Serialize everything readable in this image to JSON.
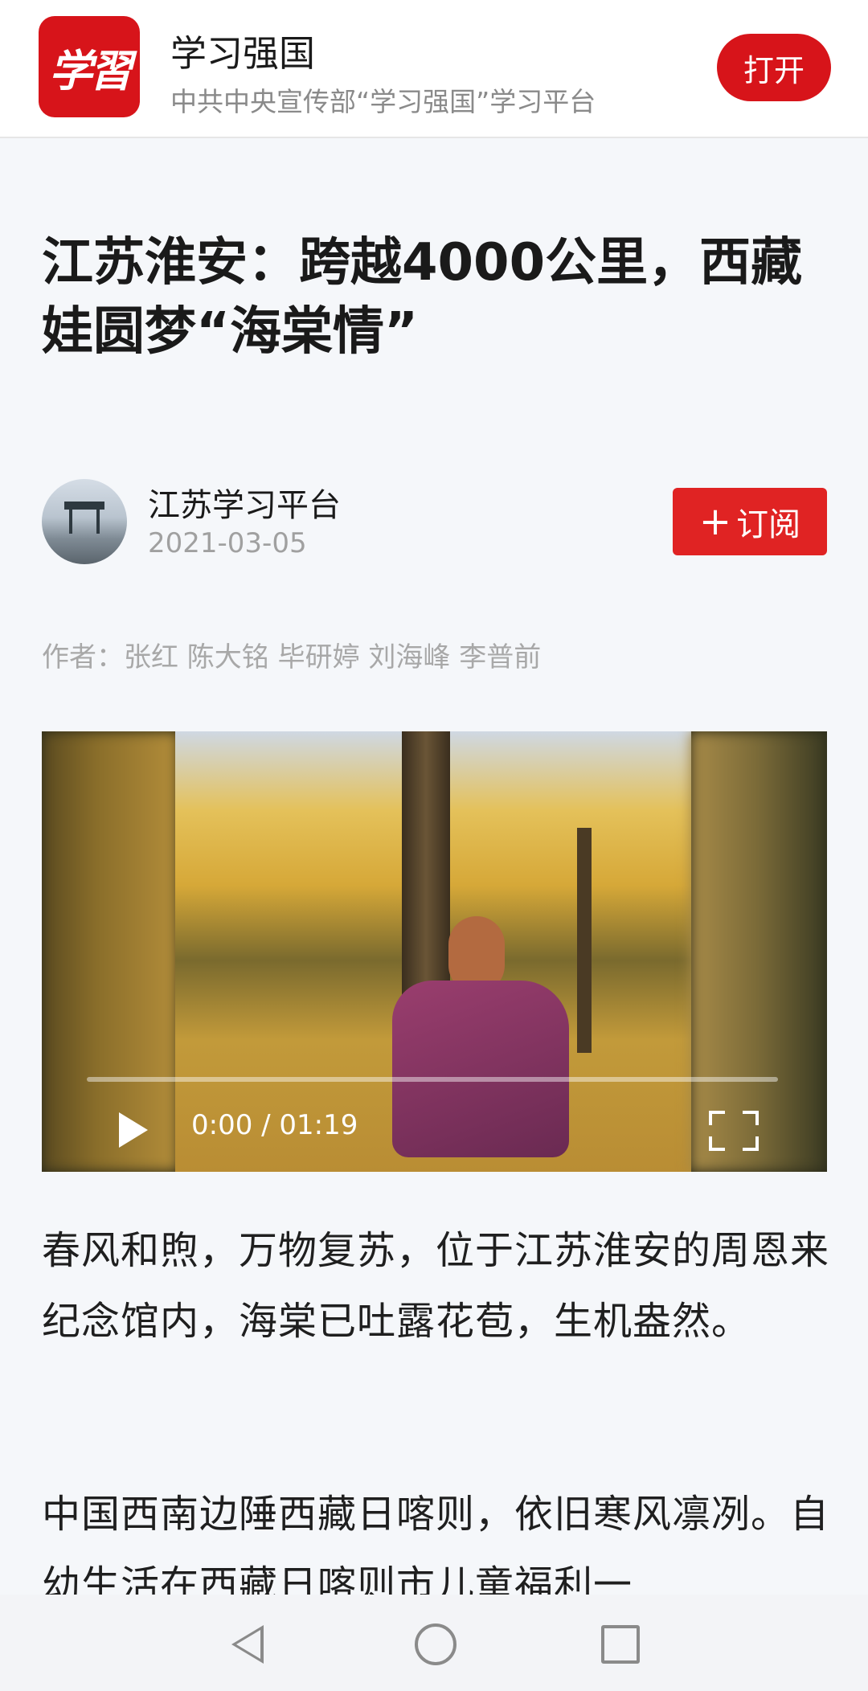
{
  "banner": {
    "logo_text": "学習",
    "app_name": "学习强国",
    "app_desc": "中共中央宣传部“学习强国”学习平台",
    "open_label": "打开"
  },
  "article": {
    "title": "江苏淮安：跨越4000公里，西藏娃圆梦“海棠情”",
    "source_name": "江苏学习平台",
    "date": "2021-03-05",
    "subscribe_label": "订阅",
    "authors": "作者：张红 陈大铭 毕研婷 刘海峰 李普前",
    "paragraphs": [
      "春风和煦，万物复苏，位于江苏淮安的周恩来纪念馆内，海棠已吐露花苞，生机盎然。",
      "中国西南边陲西藏日喀则，依旧寒风凛冽。自幼生活在西藏日喀则市儿童福利一"
    ]
  },
  "video": {
    "time_text": "0:00 / 01:19",
    "progress": 0
  },
  "navbar": {
    "back_icon": "back-triangle-icon",
    "home_icon": "home-circle-icon",
    "recent_icon": "recent-square-icon"
  }
}
